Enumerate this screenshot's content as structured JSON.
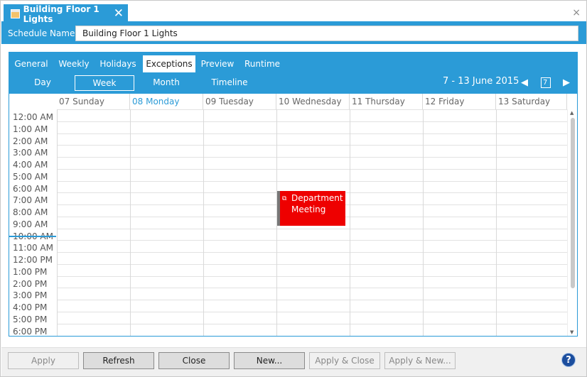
{
  "document_tab": {
    "title": "Building Floor 1 Lights",
    "close_glyph": "✕"
  },
  "window": {
    "close_glyph": "×"
  },
  "schedule": {
    "name_label": "Schedule  Name:",
    "name_value": "Building Floor 1 Lights"
  },
  "tabs": [
    {
      "label": "General"
    },
    {
      "label": "Weekly"
    },
    {
      "label": "Holidays"
    },
    {
      "label": "Exceptions",
      "active": true
    },
    {
      "label": "Preview"
    },
    {
      "label": "Runtime"
    }
  ],
  "views": [
    {
      "label": "Day"
    },
    {
      "label": "Week",
      "active": true
    },
    {
      "label": "Month"
    },
    {
      "label": "Timeline"
    }
  ],
  "date_range": "7  - 13 June 2015",
  "calendar_button_text": "7",
  "days": [
    "07 Sunday",
    "08 Monday",
    "09 Tuesday",
    "10 Wednesday",
    "11 Thursday",
    "12 Friday",
    "13 Saturday"
  ],
  "today_index": 1,
  "times": [
    "12:00 AM",
    "1:00 AM",
    "2:00 AM",
    "3:00 AM",
    "4:00 AM",
    "5:00 AM",
    "6:00 AM",
    "7:00 AM",
    "8:00 AM",
    "9:00 AM",
    "10:00 AM",
    "11:00 AM",
    "12:00 PM",
    "1:00 PM",
    "2:00 PM",
    "3:00 PM",
    "4:00 PM",
    "5:00 PM",
    "6:00 PM"
  ],
  "event": {
    "title": "Department Meeting",
    "day": "10 Wednesday",
    "start": "7:00 AM",
    "end": "10:00 AM",
    "color": "#ee0000"
  },
  "buttons": {
    "apply": "Apply",
    "refresh": "Refresh",
    "close": "Close",
    "new": "New...",
    "apply_close": "Apply & Close",
    "apply_new": "Apply & New..."
  },
  "help_glyph": "?",
  "colors": {
    "accent": "#2b9bd7",
    "event": "#ee0000"
  }
}
